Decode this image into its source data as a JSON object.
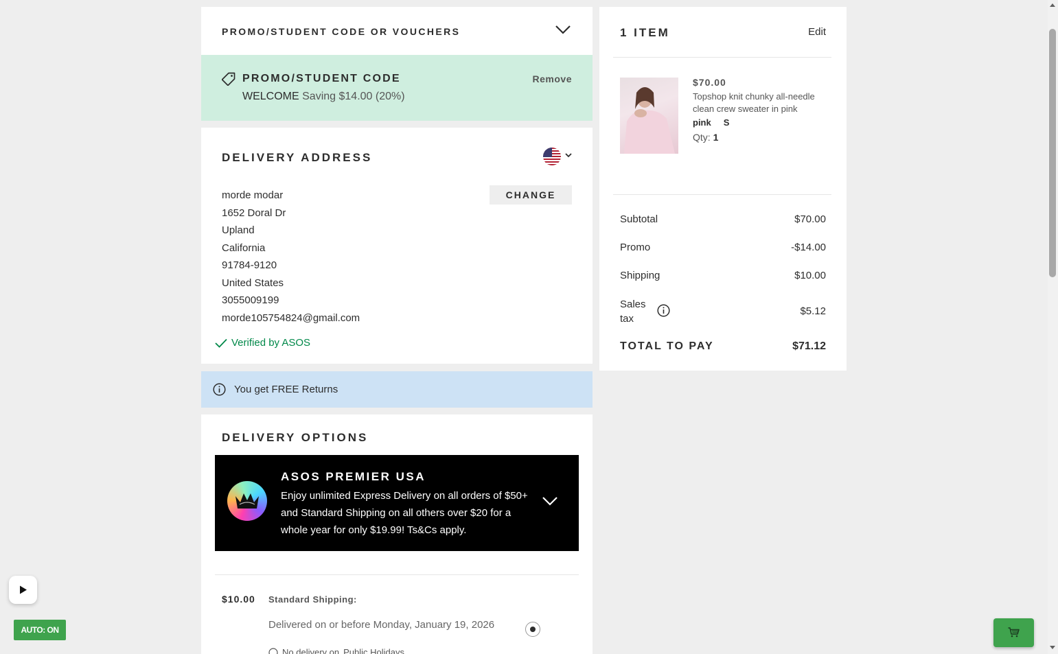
{
  "promo_section": {
    "title": "PROMO/STUDENT CODE OR VOUCHERS"
  },
  "promo_applied": {
    "title": "PROMO/STUDENT CODE",
    "code": "WELCOME",
    "saving": "Saving $14.00 (20%)",
    "remove_label": "Remove",
    "bg_color": "#cfeedf"
  },
  "delivery_address": {
    "title": "DELIVERY ADDRESS",
    "country_flag": "us-flag-icon",
    "change_label": "CHANGE",
    "lines": [
      "morde modar",
      "1652 Doral Dr",
      "Upland",
      "California",
      "91784-9120",
      "United States",
      "3055009199",
      "morde105754824@gmail.com"
    ],
    "verified": "Verified by ASOS"
  },
  "returns_banner": {
    "text": "You get FREE Returns",
    "bg_color": "#cde2f5"
  },
  "delivery_options": {
    "title": "DELIVERY OPTIONS",
    "premier": {
      "title": "ASOS PREMIER USA",
      "description": "Enjoy unlimited Express Delivery on all orders of $50+ and Standard Shipping on all others over $20 for a whole year for only $19.99! Ts&Cs apply."
    },
    "standard": {
      "price": "$10.00",
      "method": "Standard Shipping:",
      "date": "Delivered on or before Monday, January 19, 2026",
      "selected": true,
      "holidays_prefix": "No delivery on",
      "holidays_link": "Public Holidays"
    }
  },
  "summary": {
    "item_count": "1 ITEM",
    "edit_label": "Edit",
    "item": {
      "price": "$70.00",
      "name": "Topshop knit chunky all-needle clean crew sweater in pink",
      "color": "pink",
      "size": "S",
      "qty_label": "Qty:",
      "qty": "1"
    },
    "rows": {
      "subtotal_label": "Subtotal",
      "subtotal": "$70.00",
      "promo_label": "Promo",
      "promo": "-$14.00",
      "shipping_label": "Shipping",
      "shipping": "$10.00",
      "tax_label": "Sales tax",
      "tax": "$5.12",
      "total_label": "TOTAL TO PAY",
      "total": "$71.12"
    }
  },
  "overlay": {
    "auto_label": "AUTO: ON",
    "accent_color": "#3fa34d"
  }
}
